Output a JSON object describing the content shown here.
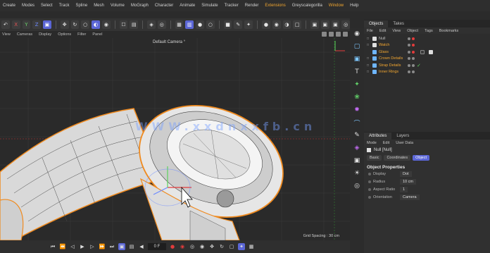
{
  "menubar": {
    "items": [
      {
        "label": "Create"
      },
      {
        "label": "Modes"
      },
      {
        "label": "Select"
      },
      {
        "label": "Track"
      },
      {
        "label": "Spline"
      },
      {
        "label": "Mesh"
      },
      {
        "label": "Volume"
      },
      {
        "label": "MoGraph"
      },
      {
        "label": "Character"
      },
      {
        "label": "Animate"
      },
      {
        "label": "Simulate"
      },
      {
        "label": "Tracker"
      },
      {
        "label": "Render"
      },
      {
        "label": "Extensions",
        "accent": true
      },
      {
        "label": "Greyscalegorilla"
      },
      {
        "label": "Window",
        "accent": true
      },
      {
        "label": "Help"
      }
    ]
  },
  "toolbar": {
    "axis_x": "X",
    "axis_y": "Y",
    "axis_z": "Z"
  },
  "viewmenu": {
    "items": [
      "View",
      "Cameras",
      "Display",
      "Options",
      "Filter",
      "Panel"
    ]
  },
  "viewport": {
    "camera_label": "Default Camera °",
    "watermark": "WWW.xxdnxxfb.cn",
    "grid_spacing": "Grid Spacing : 30 cm",
    "accent_orange": "#f0a530",
    "selection_outline": "#f08a1e"
  },
  "timeline": {
    "frame": "0 F"
  },
  "objects_panel": {
    "tabs": [
      "Objects",
      "Takes"
    ],
    "menu": [
      "File",
      "Edit",
      "View",
      "Object",
      "Tags",
      "Bookmarks"
    ],
    "items": [
      {
        "name": "Null",
        "color": "#bdbdbd",
        "icon_color": "#e0e0e0"
      },
      {
        "name": "Watch",
        "color": "#f0a530",
        "icon_color": "#e0e0e0"
      },
      {
        "name": "Glass",
        "color": "#f0a530",
        "icon_color": "#6fb6ff"
      },
      {
        "name": "Crown Details",
        "color": "#f0a530",
        "icon_color": "#6fb6ff"
      },
      {
        "name": "Strap Details",
        "color": "#f0a530",
        "icon_color": "#6fb6ff"
      },
      {
        "name": "Inner Rings",
        "color": "#f0a530",
        "icon_color": "#6fb6ff"
      }
    ]
  },
  "attributes_panel": {
    "tabs": [
      "Attributes",
      "Layers"
    ],
    "menu": [
      "Mode",
      "Edit",
      "User Data"
    ],
    "object_name": "Null [Null]",
    "modes": [
      "Basic",
      "Coordinates",
      "Object"
    ],
    "section_title": "Object Properties",
    "properties": [
      {
        "label": "Display",
        "value": "Dot"
      },
      {
        "label": "Radius",
        "value": "10 cm"
      },
      {
        "label": "Aspect Ratio",
        "value": "1"
      },
      {
        "label": "Orientation",
        "value": "Camera"
      }
    ]
  }
}
